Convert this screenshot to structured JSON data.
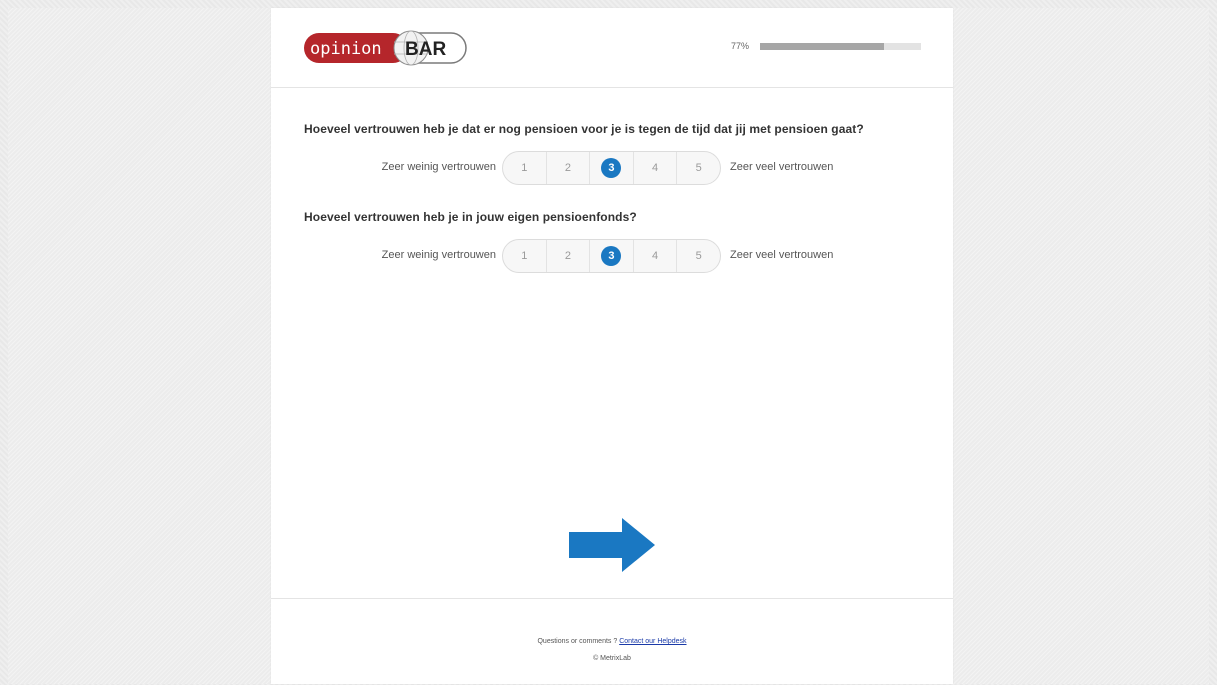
{
  "header": {
    "logo_text_left": "opinion",
    "logo_text_right": "BAR",
    "progress_label": "77%",
    "progress_value": 0.77
  },
  "questions": [
    {
      "text": "Hoeveel vertrouwen heb je dat er nog pensioen voor je is tegen de tijd dat jij met pensioen gaat?",
      "low_label": "Zeer weinig vertrouwen",
      "high_label": "Zeer veel vertrouwen",
      "options": [
        "1",
        "2",
        "3",
        "4",
        "5"
      ],
      "selected": "3"
    },
    {
      "text": "Hoeveel vertrouwen heb je in jouw eigen pensioenfonds?",
      "low_label": "Zeer weinig vertrouwen",
      "high_label": "Zeer veel vertrouwen",
      "options": [
        "1",
        "2",
        "3",
        "4",
        "5"
      ],
      "selected": "3"
    }
  ],
  "next_button": {
    "icon": "arrow-right-icon",
    "color": "#1a78c2"
  },
  "footer": {
    "prefix": "Questions or comments ? ",
    "link": "Contact our Helpdesk",
    "copyright": "© MetrixLab"
  },
  "colors": {
    "brand_red": "#b5262b",
    "accent_blue": "#1a78c2"
  }
}
